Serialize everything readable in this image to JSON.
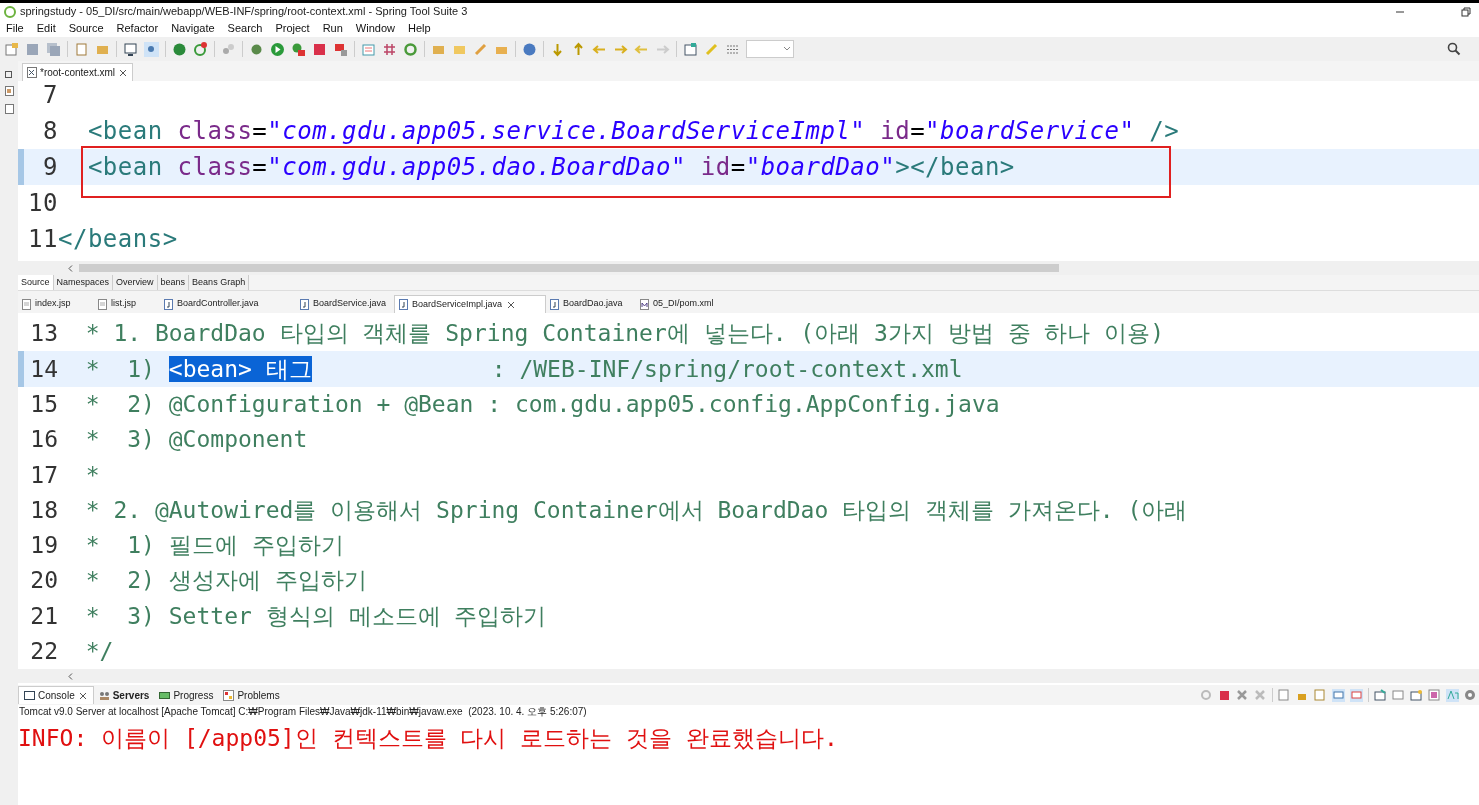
{
  "window": {
    "title": "springstudy - 05_DI/src/main/webapp/WEB-INF/spring/root-context.xml - Spring Tool Suite 3"
  },
  "menu": [
    "File",
    "Edit",
    "Source",
    "Refactor",
    "Navigate",
    "Search",
    "Project",
    "Run",
    "Window",
    "Help"
  ],
  "editor_tabs": [
    {
      "label": "*root-context.xml",
      "selected": true
    }
  ],
  "xml_editor": {
    "lines": [
      {
        "number": "7",
        "current": false,
        "marked": false
      },
      {
        "number": "8",
        "current": false,
        "marked": false,
        "segments": [
          {
            "kind": "tag",
            "text": "  <bean "
          },
          {
            "kind": "attr",
            "text": "class"
          },
          {
            "kind": "plain",
            "text": "="
          },
          {
            "kind": "string",
            "text": "\"com.gdu.app05.service.BoardServiceImpl\""
          },
          {
            "kind": "attr",
            "text": " id"
          },
          {
            "kind": "plain",
            "text": "="
          },
          {
            "kind": "string",
            "text": "\"boardService\""
          },
          {
            "kind": "tag",
            "text": " />"
          }
        ]
      },
      {
        "number": "9",
        "current": true,
        "marked": true,
        "segments": [
          {
            "kind": "tag",
            "text": "  <bean "
          },
          {
            "kind": "attr",
            "text": "class"
          },
          {
            "kind": "plain",
            "text": "="
          },
          {
            "kind": "string",
            "text": "\"com.gdu.app05.dao.BoardDao\""
          },
          {
            "kind": "attr",
            "text": " id"
          },
          {
            "kind": "plain",
            "text": "="
          },
          {
            "kind": "string",
            "text": "\"boardDao\""
          },
          {
            "kind": "tag",
            "text": "></bean>"
          }
        ]
      },
      {
        "number": "10",
        "current": false,
        "marked": false
      },
      {
        "number": "11",
        "current": false,
        "marked": false,
        "segments": [
          {
            "kind": "tag",
            "text": "</beans>"
          }
        ]
      }
    ]
  },
  "page_tabs": [
    {
      "label": "Source",
      "selected": true
    },
    {
      "label": "Namespaces",
      "selected": false
    },
    {
      "label": "Overview",
      "selected": false
    },
    {
      "label": "beans",
      "selected": false
    },
    {
      "label": "Beans Graph",
      "selected": false
    }
  ],
  "file_tabs": [
    {
      "label": "index.jsp",
      "kind": "jsp",
      "selected": false
    },
    {
      "label": "list.jsp",
      "kind": "jsp",
      "selected": false
    },
    {
      "label": "BoardController.java",
      "kind": "java",
      "selected": false
    },
    {
      "label": "BoardService.java",
      "kind": "java",
      "selected": false
    },
    {
      "label": "BoardServiceImpl.java",
      "kind": "java",
      "selected": true
    },
    {
      "label": "BoardDao.java",
      "kind": "java",
      "selected": false
    },
    {
      "label": "05_DI/pom.xml",
      "kind": "maven",
      "selected": false
    }
  ],
  "java_editor": {
    "lines": [
      {
        "number": "13",
        "current": false,
        "segments": [
          {
            "kind": "comment",
            "text": "  * 1. BoardDao 타입의 객체를 Spring Container에 넣는다. (아래 3가지 방법 중 하나 이용)"
          }
        ]
      },
      {
        "number": "14",
        "current": true,
        "segments": [
          {
            "kind": "comment",
            "text": "  *  1) "
          },
          {
            "kind": "selected",
            "text": "<bean> 태그"
          },
          {
            "kind": "comment",
            "text": "             : /WEB-INF/spring/root-context.xml"
          }
        ]
      },
      {
        "number": "15",
        "current": false,
        "segments": [
          {
            "kind": "comment",
            "text": "  *  2) @Configuration + @Bean : com.gdu.app05.config.AppConfig.java"
          }
        ]
      },
      {
        "number": "16",
        "current": false,
        "segments": [
          {
            "kind": "comment",
            "text": "  *  3) @Component"
          }
        ]
      },
      {
        "number": "17",
        "current": false,
        "segments": [
          {
            "kind": "comment",
            "text": "  *"
          }
        ]
      },
      {
        "number": "18",
        "current": false,
        "segments": [
          {
            "kind": "comment",
            "text": "  * 2. @Autowired를 이용해서 Spring Container에서 BoardDao 타입의 객체를 가져온다. (아래"
          }
        ]
      },
      {
        "number": "19",
        "current": false,
        "segments": [
          {
            "kind": "comment",
            "text": "  *  1) 필드에 주입하기"
          }
        ]
      },
      {
        "number": "20",
        "current": false,
        "segments": [
          {
            "kind": "comment",
            "text": "  *  2) 생성자에 주입하기"
          }
        ]
      },
      {
        "number": "21",
        "current": false,
        "segments": [
          {
            "kind": "comment",
            "text": "  *  3) Setter 형식의 메소드에 주입하기"
          }
        ]
      },
      {
        "number": "22",
        "current": false,
        "segments": [
          {
            "kind": "comment",
            "text": "  */"
          }
        ]
      }
    ]
  },
  "console_tabs": [
    {
      "label": "Console",
      "selected": true
    },
    {
      "label": "Servers",
      "selected": false
    },
    {
      "label": "Progress",
      "selected": false
    },
    {
      "label": "Problems",
      "selected": false
    }
  ],
  "console": {
    "process": "Tomcat v9.0 Server at localhost [Apache Tomcat] C:₩Program Files₩Java₩jdk-11₩bin₩javaw.exe  (2023. 10. 4. 오후 5:26:07)",
    "lines": [
      "INFO: 이름이 [/app05]인 컨텍스트를 다시 로드하는 것을 완료했습니다."
    ]
  }
}
